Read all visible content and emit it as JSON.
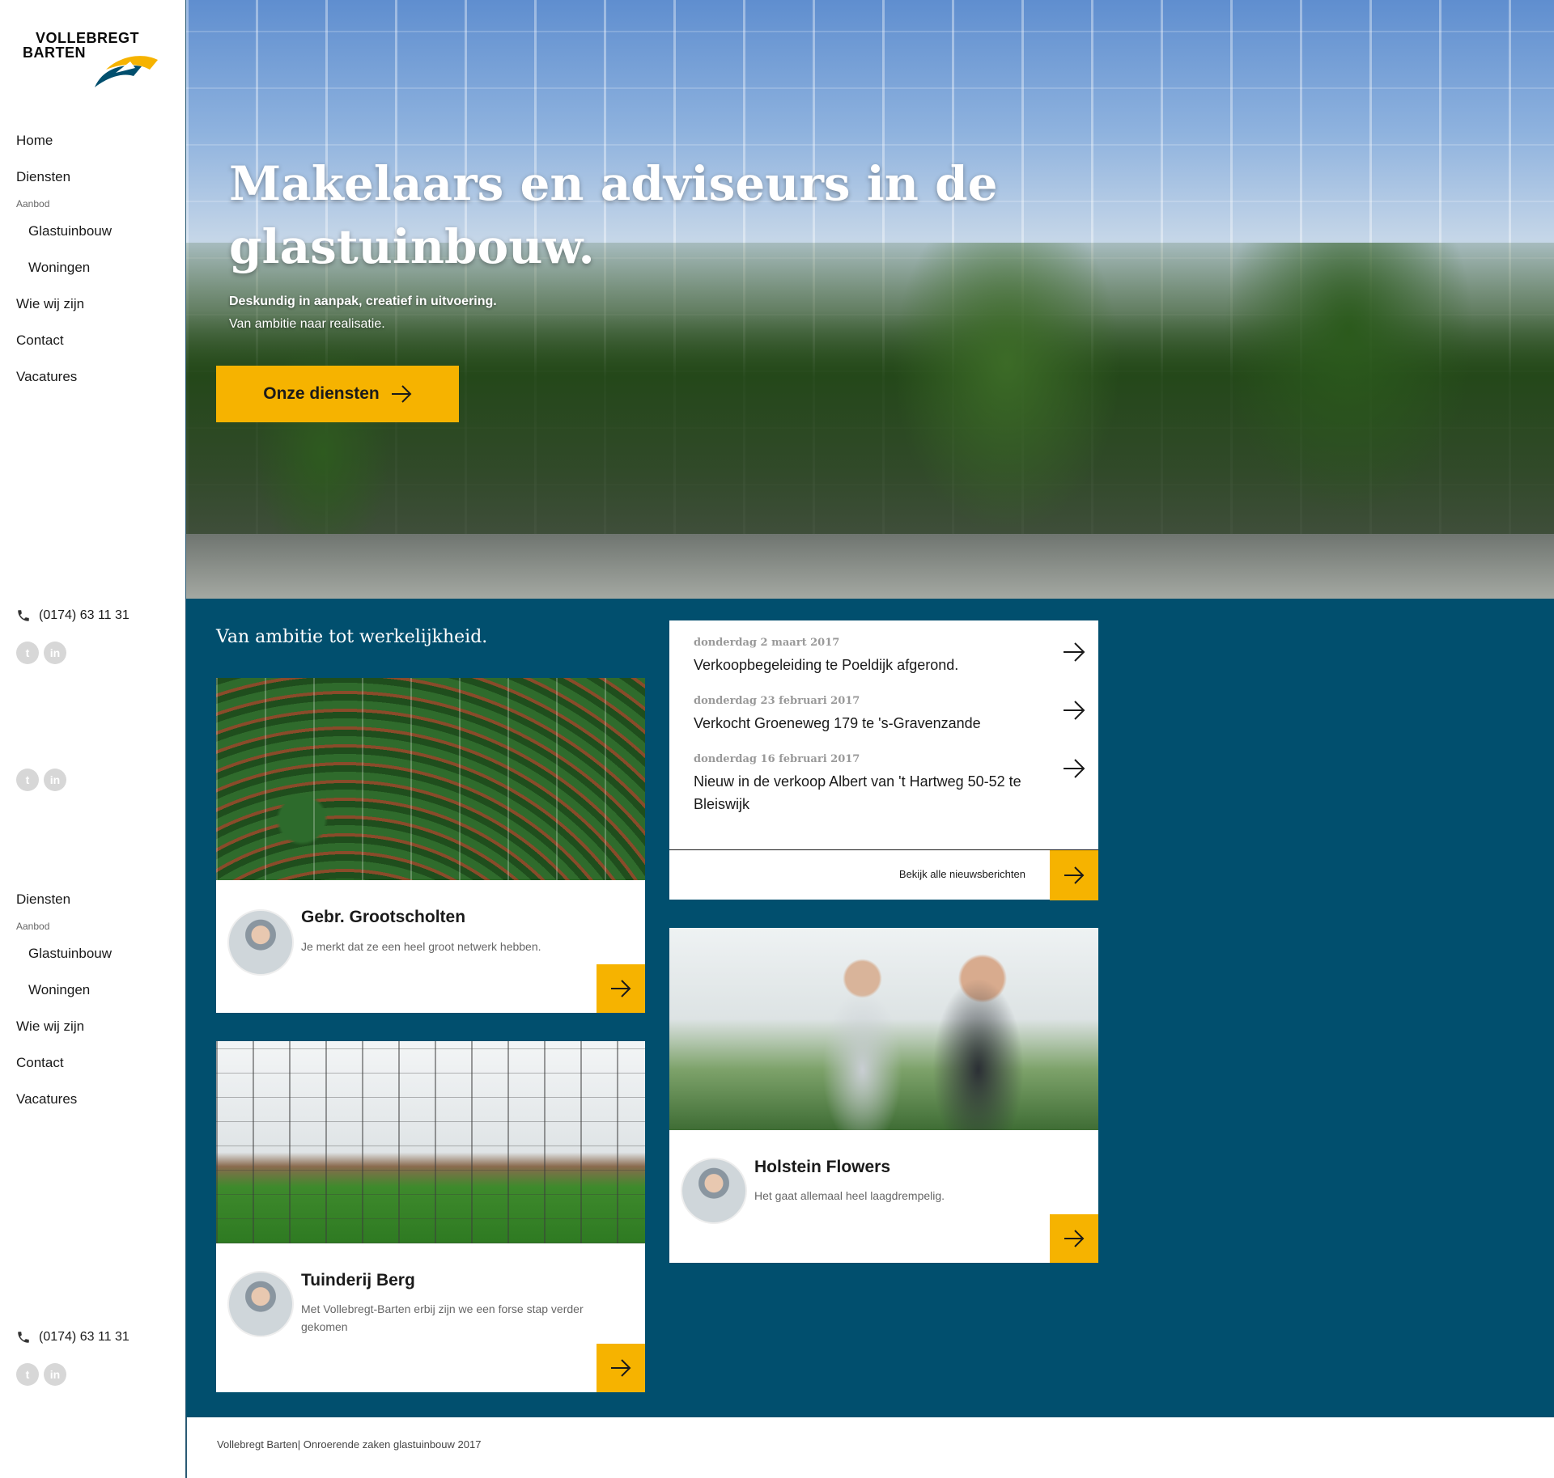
{
  "logo": {
    "line1": "VOLLEBREGT",
    "line2": "BARTEN",
    "colors": {
      "navy": "#014f6e",
      "yellow": "#f6b300"
    }
  },
  "nav": {
    "items": [
      {
        "label": "Home"
      },
      {
        "label": "Diensten"
      },
      {
        "label": "Aanbod"
      },
      {
        "label": "Glastuinbouw"
      },
      {
        "label": "Woningen"
      },
      {
        "label": "Wie wij zijn"
      },
      {
        "label": "Contact"
      },
      {
        "label": "Vacatures"
      }
    ],
    "phone": "(0174) 63 11 31",
    "social": [
      "twitter-icon",
      "linkedin-icon"
    ]
  },
  "footer_nav": {
    "items": [
      {
        "label": "Diensten"
      },
      {
        "label": "Aanbod"
      },
      {
        "label": "Glastuinbouw"
      },
      {
        "label": "Woningen"
      },
      {
        "label": "Wie wij zijn"
      },
      {
        "label": "Contact"
      },
      {
        "label": "Vacatures"
      }
    ],
    "phone": "(0174) 63 11 31"
  },
  "hero": {
    "title": "Makelaars en adviseurs in de glastuinbouw.",
    "subtitle_bold": "Deskundig in aanpak, creatief in uitvoering.",
    "subtitle": "Van ambitie naar realisatie.",
    "button": "Onze diensten"
  },
  "section": {
    "title": "Van ambitie tot werkelijkheid."
  },
  "testimonials": [
    {
      "name": "Gebr. Grootscholten",
      "quote": "Je merkt dat ze een heel groot netwerk hebben."
    },
    {
      "name": "Tuinderij Berg",
      "quote": "Met Vollebregt-Barten erbij zijn we een forse stap verder gekomen"
    },
    {
      "name": "Holstein Flowers",
      "quote": "Het gaat allemaal heel laagdrempelig."
    }
  ],
  "news": {
    "items": [
      {
        "date": "donderdag 2 maart 2017",
        "title": "Verkoopbegeleiding te Poeldijk afgerond."
      },
      {
        "date": "donderdag 23 februari 2017",
        "title": "Verkocht Groeneweg 179 te 's-Gravenzande"
      },
      {
        "date": "donderdag 16 februari 2017",
        "title": "Nieuw in de verkoop Albert van 't Hartweg 50-52 te Bleiswijk"
      }
    ],
    "all_label": "Bekijk alle nieuwsberichten"
  },
  "footer": {
    "text": "Vollebregt Barten| Onroerende zaken glastuinbouw 2017"
  }
}
